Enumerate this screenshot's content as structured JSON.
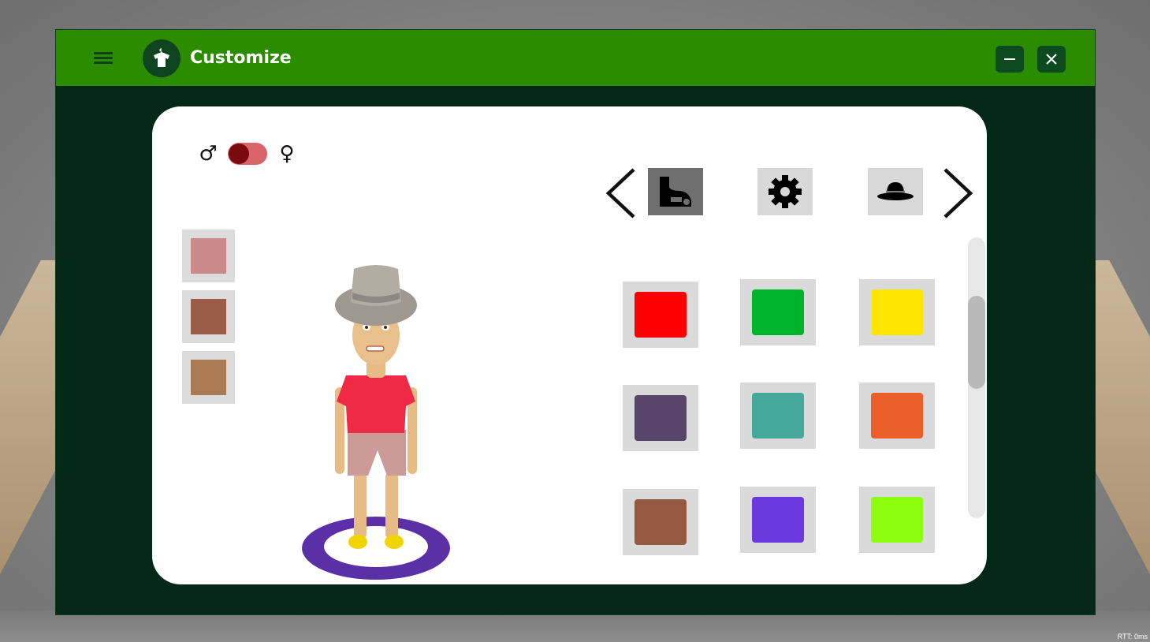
{
  "window": {
    "title": "Customize",
    "minimize_icon": "minimize-icon",
    "close_icon": "close-icon",
    "menu_icon": "hamburger-menu-icon",
    "logo_icon": "shirt-hanger-icon",
    "titlebar_color": "#2b8c00",
    "body_color": "#032818"
  },
  "gender": {
    "male_symbol": "♂",
    "female_symbol": "♀",
    "toggle_on_color": "#7a0a0d",
    "toggle_track_color": "#d9646a"
  },
  "skin_tones": [
    "#c98a89",
    "#9c5d48",
    "#a97a53"
  ],
  "categories": {
    "items": [
      {
        "name": "shoes",
        "icon": "shoe-icon",
        "active": true
      },
      {
        "name": "settings",
        "icon": "gear-icon",
        "active": false
      },
      {
        "name": "hats",
        "icon": "hat-icon",
        "active": false
      }
    ],
    "prev_icon": "chevron-left-icon",
    "next_icon": "chevron-right-icon"
  },
  "colors": [
    "#ff0000",
    "#00b32d",
    "#ffe600",
    "#57456b",
    "#46a89b",
    "#ea5f2a",
    "#965a43",
    "#6a38dc",
    "#8cff0f"
  ],
  "rtt": "RTT: 0ms"
}
